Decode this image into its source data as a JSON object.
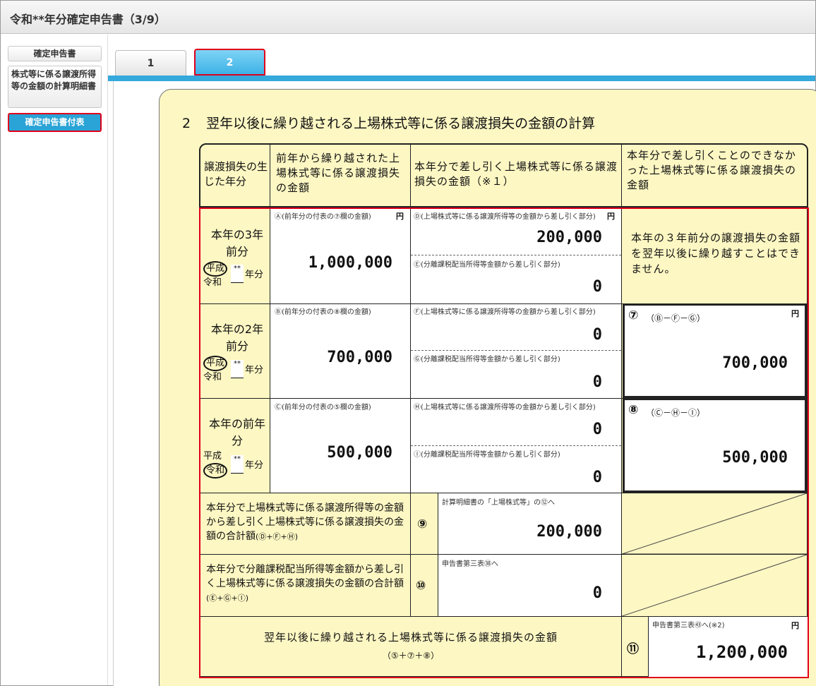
{
  "window": {
    "title": "令和**年分確定申告書（3/9）"
  },
  "sidebar": {
    "items": [
      {
        "label": "確定申告書"
      },
      {
        "label": "株式等に係る譲渡所得等の金額の計算明細書"
      },
      {
        "label": "確定申告書付表"
      }
    ]
  },
  "tabs": [
    {
      "label": "1"
    },
    {
      "label": "2"
    }
  ],
  "form": {
    "section_number": "2",
    "section_title": "翌年以後に繰り越される上場株式等に係る譲渡損失の金額の計算",
    "headers": {
      "col1": "譲渡損失の生じた年分",
      "col2": "前年から繰り越された上場株式等に係る譲渡損失の金額",
      "col3": "本年分で差し引く上場株式等に係る譲渡損失の金額（※１）",
      "col4": "本年分で差し引くことのできなかった上場株式等に係る譲渡損失の金額"
    },
    "era": {
      "heisei": "平成",
      "reiwa": "令和",
      "stars": "**",
      "nenbun": "年分"
    },
    "yen": "円",
    "rows": [
      {
        "year_label": "本年の3年前分",
        "a_label": "Ⓐ(前年分の付表の⑦欄の金額)",
        "a_value": "1,000,000",
        "d_label": "Ⓓ(上場株式等に係る譲渡所得等の金額から差し引く部分)",
        "d_value": "200,000",
        "e_label": "Ⓔ(分離課税配当所得等金額から差し引く部分)",
        "e_value": "0",
        "note": "本年の３年前分の譲渡損失の金額を翌年以後に繰り越すことはできません。"
      },
      {
        "year_label": "本年の2年前分",
        "a_label": "Ⓑ(前年分の付表の⑧欄の金額)",
        "a_value": "700,000",
        "d_label": "Ⓕ(上場株式等に係る譲渡所得等の金額から差し引く部分)",
        "d_value": "0",
        "e_label": "Ⓖ(分離課税配当所得等金額から差し引く部分)",
        "e_value": "0",
        "result_mark": "⑦",
        "result_formula": "（Ⓑ－Ⓕ－Ⓖ）",
        "result_value": "700,000"
      },
      {
        "year_label": "本年の前年分",
        "a_label": "Ⓒ(前年分の付表の⑤欄の金額)",
        "a_value": "500,000",
        "d_label": "Ⓗ(上場株式等に係る譲渡所得等の金額から差し引く部分)",
        "d_value": "0",
        "e_label": "Ⓘ(分離課税配当所得等金額から差し引く部分)",
        "e_value": "0",
        "result_mark": "⑧",
        "result_formula": "（Ⓒ－Ⓗ－Ⓘ）",
        "result_value": "500,000"
      }
    ],
    "total9": {
      "label": "本年分で上場株式等に係る譲渡所得等の金額から差し引く上場株式等に係る譲渡損失の金額の合計額",
      "formula": "(Ⓓ+Ⓕ+Ⓗ)",
      "mark": "⑨",
      "note": "計算明細書の「上場株式等」の⑫へ",
      "value": "200,000"
    },
    "total10": {
      "label": "本年分で分離課税配当所得等金額から差し引く上場株式等に係る譲渡損失の金額の合計額",
      "formula": "(Ⓔ+Ⓖ+Ⓘ)",
      "mark": "⑩",
      "note": "申告書第三表㊳へ",
      "value": "0"
    },
    "total11": {
      "label": "翌年以後に繰り越される上場株式等に係る譲渡損失の金額",
      "formula": "（⑤＋⑦＋⑧）",
      "mark": "⑪",
      "note": "申告書第三表㊸へ(※2)",
      "value": "1,200,000"
    }
  }
}
